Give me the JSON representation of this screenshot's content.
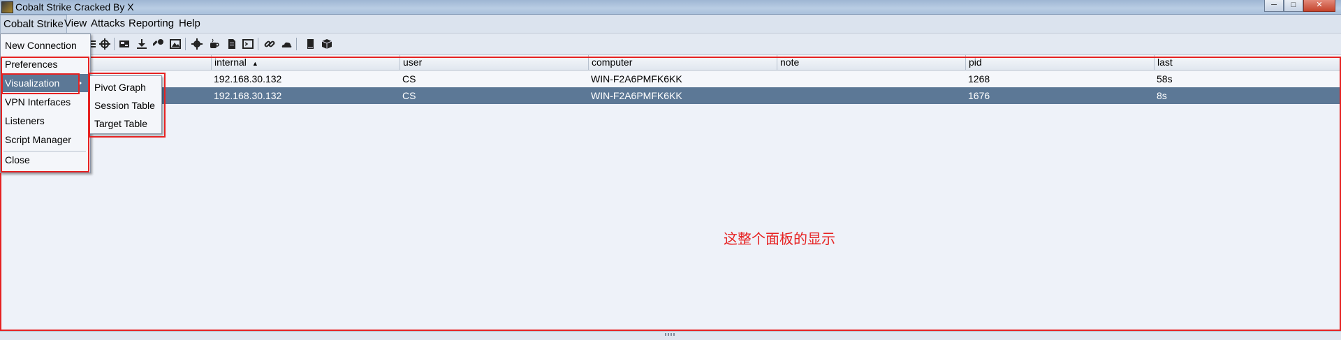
{
  "window": {
    "title": "Cobalt Strike Cracked By X",
    "min": "─",
    "max": "□",
    "close": "✕"
  },
  "menubar": {
    "items": [
      "Cobalt Strike",
      "View",
      "Attacks",
      "Reporting",
      "Help"
    ]
  },
  "toolbar": {
    "icons": [
      "targets-icon",
      "crosshair-icon",
      "screenshot-icon",
      "download-icon",
      "key-icon",
      "image-icon",
      "gear-icon",
      "coffee-icon",
      "document-icon",
      "console-icon",
      "link-icon",
      "cloud-icon",
      "book-icon",
      "cube-icon"
    ]
  },
  "table": {
    "columns": [
      "internal",
      "user",
      "computer",
      "note",
      "pid",
      "last"
    ],
    "sort_indicator": "▲",
    "rows": [
      {
        "internal": "192.168.30.132",
        "user": "CS",
        "computer": "WIN-F2A6PMFK6KK",
        "note": "",
        "pid": "1268",
        "last": "58s"
      },
      {
        "internal": "192.168.30.132",
        "user": "CS",
        "computer": "WIN-F2A6PMFK6KK",
        "note": "",
        "pid": "1676",
        "last": "8s"
      }
    ]
  },
  "cobalt_menu": {
    "items": [
      "New Connection",
      "Preferences",
      "Visualization",
      "VPN Interfaces",
      "Listeners",
      "Script Manager",
      "Close"
    ]
  },
  "visualization_menu": {
    "items": [
      "Pivot Graph",
      "Session Table",
      "Target Table"
    ]
  },
  "annotation": {
    "text": "这整个面板的显示",
    "color": "#e62222"
  },
  "colors": {
    "selection": "#5c7896",
    "table_bg": "#eef2f9"
  }
}
